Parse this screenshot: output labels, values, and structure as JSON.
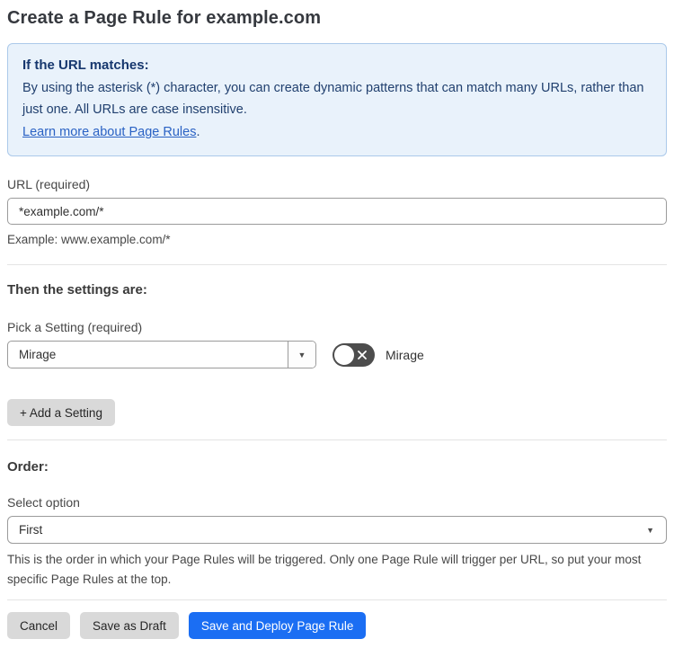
{
  "page": {
    "title": "Create a Page Rule for example.com"
  },
  "info_box": {
    "heading": "If the URL matches:",
    "body": "By using the asterisk (*) character, you can create dynamic patterns that can match many URLs, rather than just one. All URLs are case insensitive.",
    "link_text": "Learn more about Page Rules",
    "link_suffix": "."
  },
  "url_field": {
    "label": "URL (required)",
    "value": "*example.com/*",
    "helper": "Example: www.example.com/*"
  },
  "settings_section": {
    "heading": "Then the settings are:",
    "picker_label": "Pick a Setting (required)",
    "picker_value": "Mirage",
    "toggle_label": "Mirage",
    "toggle_state": "off",
    "add_button_label": "+ Add a Setting"
  },
  "order_section": {
    "heading": "Order:",
    "select_label": "Select option",
    "select_value": "First",
    "helper": "This is the order in which your Page Rules will be triggered. Only one Page Rule will trigger per URL, so put your most specific Page Rules at the top."
  },
  "footer": {
    "cancel_label": "Cancel",
    "save_draft_label": "Save as Draft",
    "save_deploy_label": "Save and Deploy Page Rule"
  },
  "icons": {
    "caret_down": "▼"
  },
  "colors": {
    "info_box_bg": "#e9f2fb",
    "info_box_border": "#abc9ea",
    "info_text": "#21406f",
    "link_blue": "#2a62c4",
    "primary_button_blue": "#1b6ef3",
    "gray_button_bg": "#d9d9d9",
    "toggle_off_bg": "#4d4d4d"
  }
}
